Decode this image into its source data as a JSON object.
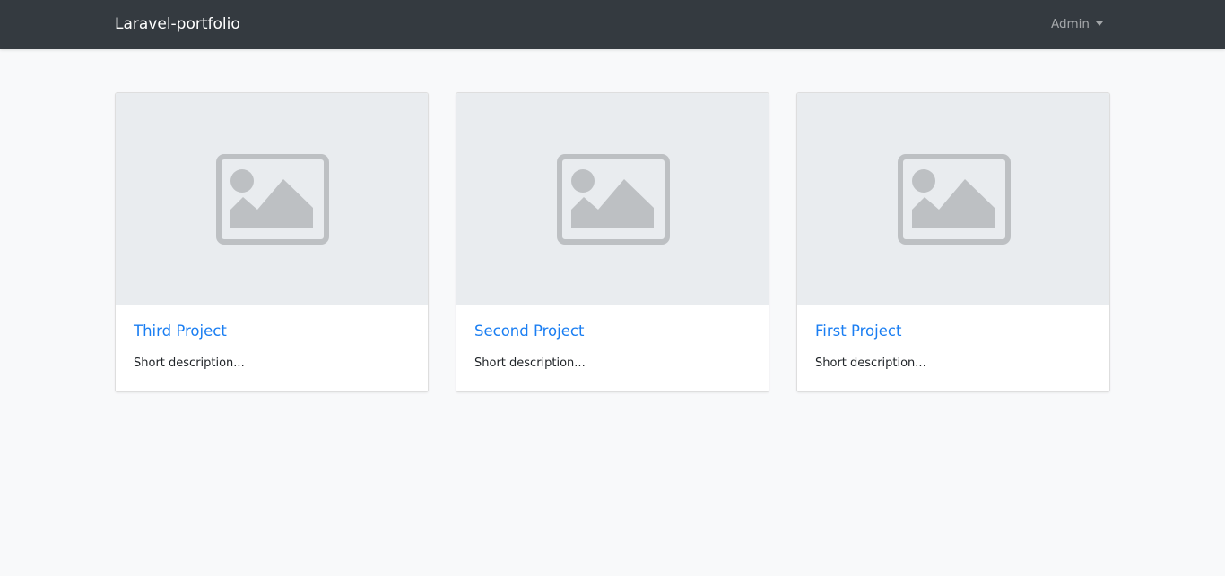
{
  "navbar": {
    "brand": "Laravel-portfolio",
    "user_menu_label": "Admin"
  },
  "projects": [
    {
      "title": "Third Project",
      "description": "Short description...",
      "image_icon": "image-placeholder-icon"
    },
    {
      "title": "Second Project",
      "description": "Short description...",
      "image_icon": "image-placeholder-icon"
    },
    {
      "title": "First Project",
      "description": "Short description...",
      "image_icon": "image-placeholder-icon"
    }
  ],
  "colors": {
    "navbar_bg": "#343a40",
    "page_bg": "#f8f9fa",
    "link": "#1a7ef2",
    "placeholder_bg": "#e9ecef",
    "placeholder_icon": "#bdc0c3"
  }
}
